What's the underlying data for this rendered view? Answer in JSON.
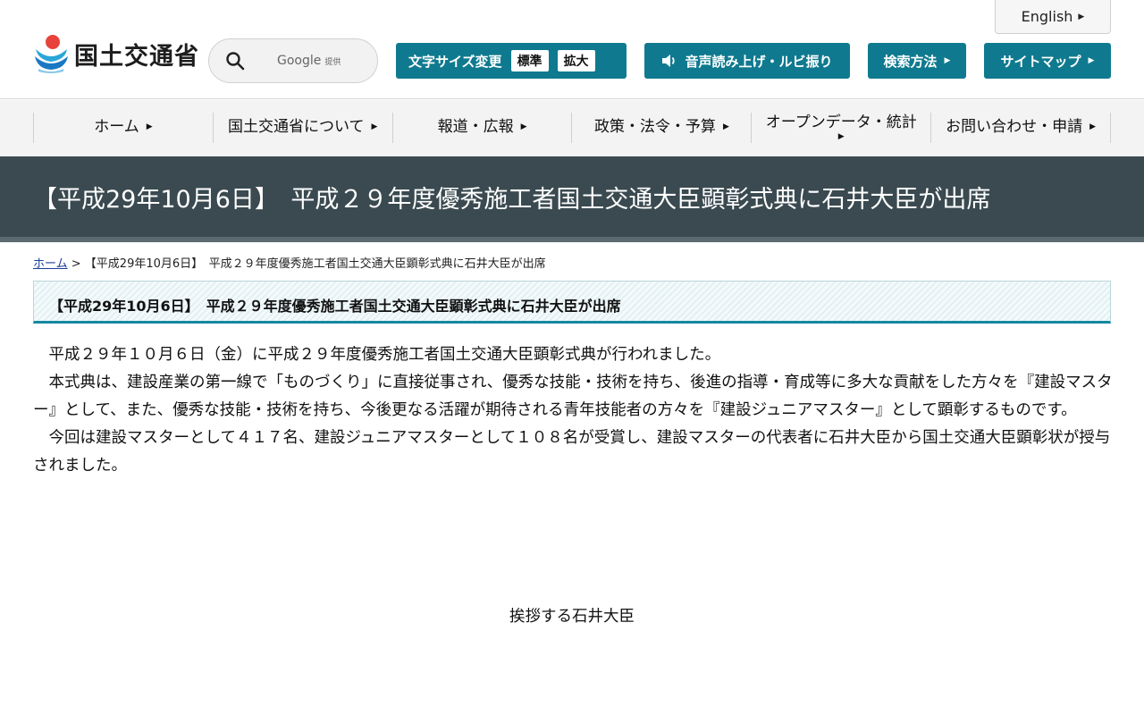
{
  "header": {
    "english_label": "English",
    "logo_text": "国土交通省",
    "search": {
      "provider": "Google",
      "provider_suffix": "提供"
    },
    "font_size_label": "文字サイズ変更",
    "font_size_standard": "標準",
    "font_size_large": "拡大",
    "voice_label": "音声読み上げ・ルビ振り",
    "search_method_label": "検索方法",
    "sitemap_label": "サイトマップ"
  },
  "nav": {
    "items": [
      {
        "label": "ホーム"
      },
      {
        "label": "国土交通省について"
      },
      {
        "label": "報道・広報"
      },
      {
        "label": "政策・法令・予算"
      },
      {
        "label": "オープンデータ・統計"
      },
      {
        "label": "お問い合わせ・申請"
      }
    ]
  },
  "page": {
    "title": "【平成29年10月6日】　平成２９年度優秀施工者国土交通大臣顕彰式典に石井大臣が出席",
    "breadcrumb_home": "ホーム",
    "breadcrumb_sep": " > ",
    "breadcrumb_current": "【平成29年10月6日】　平成２９年度優秀施工者国土交通大臣顕彰式典に石井大臣が出席",
    "section_heading": "【平成29年10月6日】　平成２９年度優秀施工者国土交通大臣顕彰式典に石井大臣が出席",
    "paragraphs": [
      "平成２９年１０月６日（金）に平成２９年度優秀施工者国土交通大臣顕彰式典が行われました。",
      "本式典は、建設産業の第一線で「ものづくり」に直接従事され、優秀な技能・技術を持ち、後進の指導・育成等に多大な貢献をした方々を『建設マスター』として、また、優秀な技能・技術を持ち、今後更なる活躍が期待される青年技能者の方々を『建設ジュニアマスター』として顕彰するものです。",
      "今回は建設マスターとして４１７名、建設ジュニアマスターとして１０８名が受賞し、建設マスターの代表者に石井大臣から国土交通大臣顕彰状が授与されました。"
    ],
    "caption": "挨拶する石井大臣"
  },
  "colors": {
    "accent": "#0f7a8f",
    "title_band": "#3a4a50",
    "nav_bg": "#f3f3f3"
  }
}
